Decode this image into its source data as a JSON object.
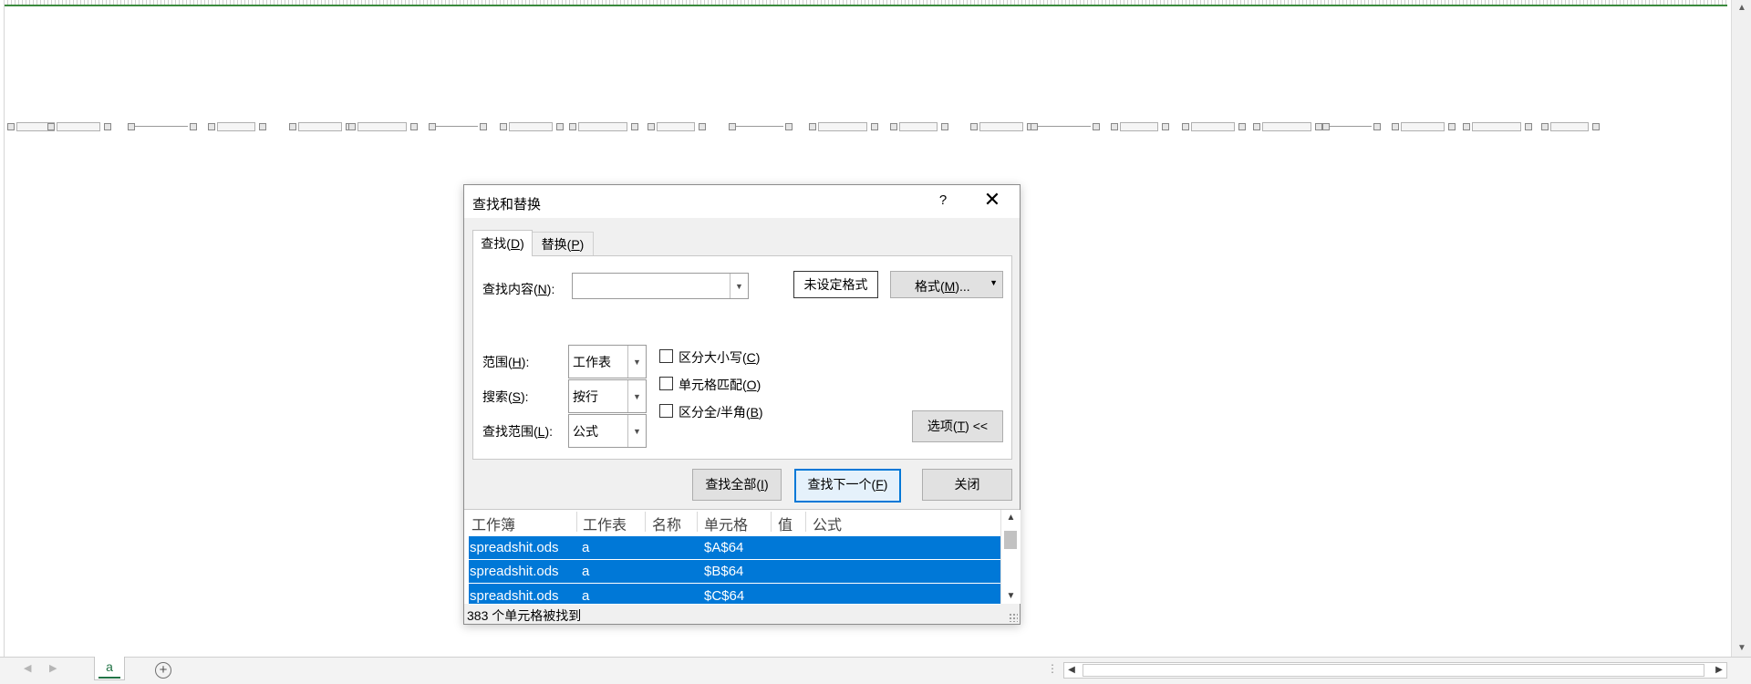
{
  "sheet": {
    "tab_label": "a",
    "add_sheet_symbol": "+",
    "nav_prev": "◀",
    "nav_next": "▶"
  },
  "dialog": {
    "title": "查找和替换",
    "help_symbol": "?",
    "close_symbol": "✕",
    "tabs": [
      {
        "label": "查找(",
        "mnemonic": "D",
        "suffix": ")"
      },
      {
        "label": "替换(",
        "mnemonic": "P",
        "suffix": ")"
      }
    ],
    "find_what_label": {
      "pre": "查找内容(",
      "key": "N",
      "post": "):"
    },
    "find_what_value": "",
    "no_format_label": "未设定格式",
    "format_button": {
      "pre": "格式(",
      "key": "M",
      "post": ")..."
    },
    "within": {
      "label_pre": "范围(",
      "key": "H",
      "label_post": "):",
      "value": "工作表"
    },
    "search": {
      "label_pre": "搜索(",
      "key": "S",
      "label_post": "):",
      "value": "按行"
    },
    "look_in": {
      "label_pre": "查找范围(",
      "key": "L",
      "label_post": "):",
      "value": "公式"
    },
    "checkboxes": [
      {
        "pre": "区分大小写(",
        "key": "C",
        "post": ")",
        "checked": false
      },
      {
        "pre": "单元格匹配(",
        "key": "O",
        "post": ")",
        "checked": false
      },
      {
        "pre": "区分全/半角(",
        "key": "B",
        "post": ")",
        "checked": false
      }
    ],
    "options_button": {
      "pre": "选项(",
      "key": "T",
      "post": ") <<"
    },
    "buttons": {
      "find_all": {
        "pre": "查找全部(",
        "key": "I",
        "post": ")"
      },
      "find_next": {
        "pre": "查找下一个(",
        "key": "F",
        "post": ")"
      },
      "close": "关闭"
    },
    "results": {
      "columns": [
        "工作簿",
        "工作表",
        "名称",
        "单元格",
        "值",
        "公式"
      ],
      "rows": [
        {
          "workbook": "spreadshit.ods",
          "sheet": "a",
          "name": "",
          "cell": "$A$64",
          "value": "",
          "formula": ""
        },
        {
          "workbook": "spreadshit.ods",
          "sheet": "a",
          "name": "",
          "cell": "$B$64",
          "value": "",
          "formula": ""
        },
        {
          "workbook": "spreadshit.ods",
          "sheet": "a",
          "name": "",
          "cell": "$C$64",
          "value": "",
          "formula": ""
        }
      ]
    },
    "status": "383 个单元格被找到"
  },
  "colors": {
    "accent": "#0078d7",
    "excel_green": "#217346",
    "dialog_bg": "#f0f0f0"
  }
}
